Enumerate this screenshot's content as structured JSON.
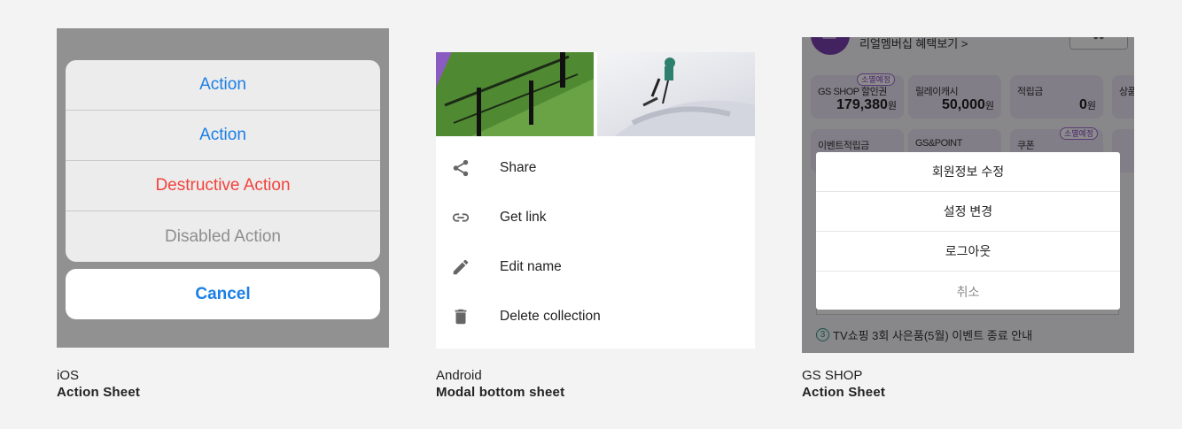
{
  "ios": {
    "actions": [
      "Action",
      "Action",
      "Destructive Action",
      "Disabled Action"
    ],
    "cancel_label": "Cancel",
    "caption_platform": "iOS",
    "caption_name": "Action Sheet"
  },
  "android": {
    "items": [
      {
        "icon": "share-icon",
        "label": "Share"
      },
      {
        "icon": "link-icon",
        "label": "Get link"
      },
      {
        "icon": "pencil-icon",
        "label": "Edit name"
      },
      {
        "icon": "trash-icon",
        "label": "Delete collection"
      }
    ],
    "caption_platform": "Android",
    "caption_name": "Modal bottom sheet"
  },
  "gsshop": {
    "membership_label": "리얼멤버십 혜택보기 >",
    "cards": [
      {
        "label": "GS SHOP 할인권",
        "value": "179,380",
        "unit": "원",
        "badge": "소멸예정"
      },
      {
        "label": "릴레이캐시",
        "value": "50,000",
        "unit": "원"
      },
      {
        "label": "적립금",
        "value": "0",
        "unit": "원"
      },
      {
        "label": "상품"
      },
      {
        "label": "이벤트적립금"
      },
      {
        "label": "GS&POINT"
      },
      {
        "label": "쿠폰",
        "badge": "소멸예정"
      }
    ],
    "actions": [
      "회원정보 수정",
      "설정 변경",
      "로그아웃",
      "취소"
    ],
    "notice_number": "3",
    "notice_text": "TV쇼핑 3회 사은품(5월) 이벤트 종료 안내",
    "caption_platform": "GS SHOP",
    "caption_name": "Action Sheet"
  },
  "colors": {
    "ios_blue": "#1a7fe6",
    "ios_red": "#f2423c",
    "ios_disabled": "#8e8e8e",
    "gs_purple": "#8a44c9"
  }
}
